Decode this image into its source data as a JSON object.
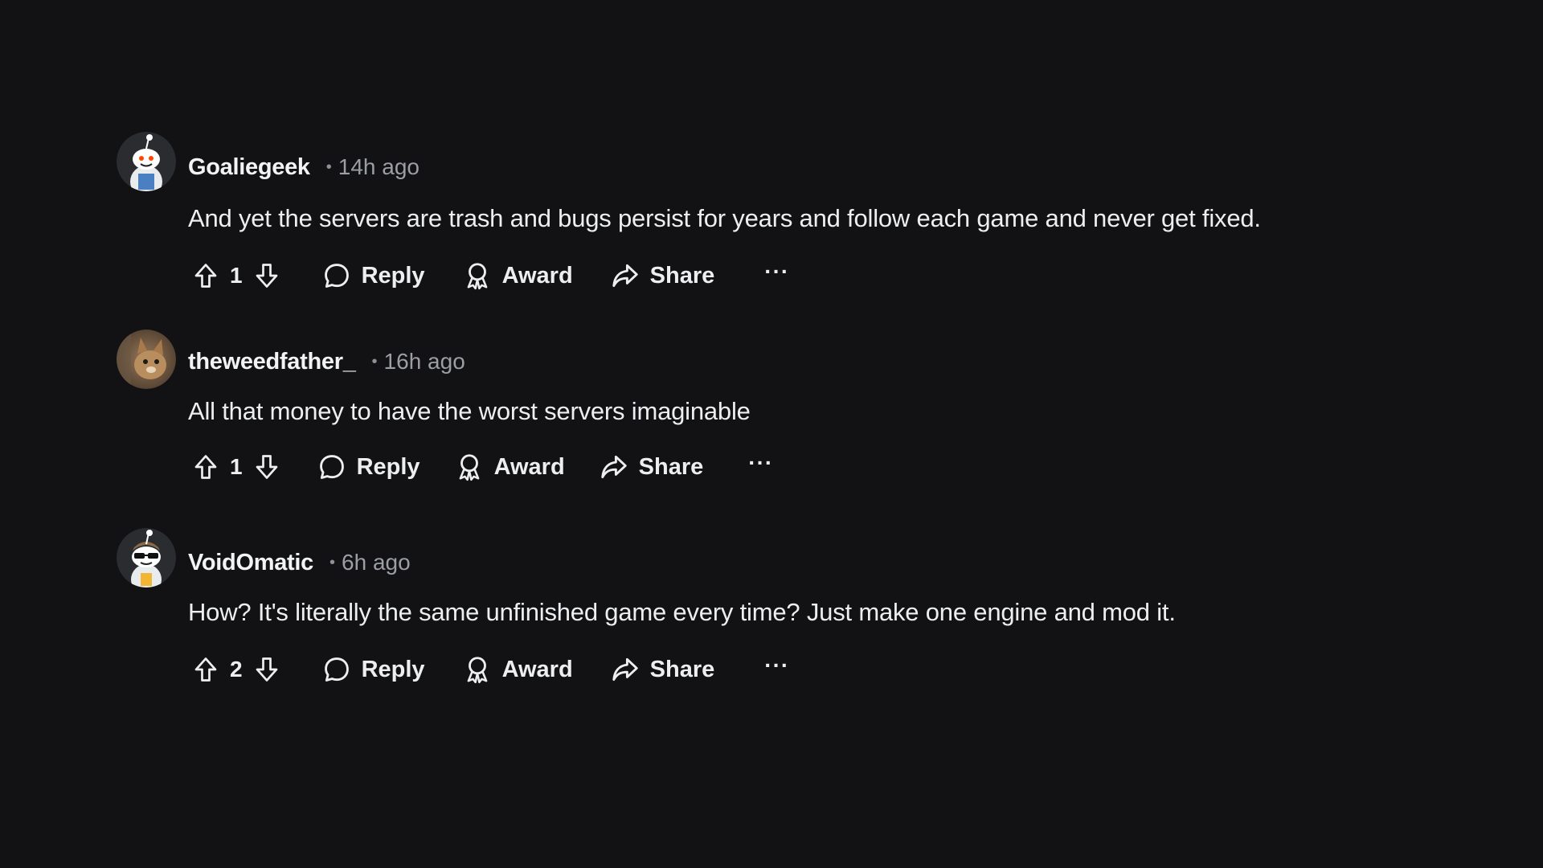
{
  "comments": [
    {
      "username": "Goaliegeek",
      "separator": "•",
      "time": "14h ago",
      "text": "And yet the servers are trash and bugs persist for years and follow each game and never get fixed.",
      "score": "1",
      "reply_label": "Reply",
      "award_label": "Award",
      "share_label": "Share",
      "more_label": "···",
      "avatar_icon": "snoo-avatar-icon"
    },
    {
      "username": "theweedfather_",
      "separator": "•",
      "time": "16h ago",
      "text": "All that money to have the worst servers imaginable",
      "score": "1",
      "reply_label": "Reply",
      "award_label": "Award",
      "share_label": "Share",
      "more_label": "···",
      "avatar_icon": "cat-photo-avatar-icon"
    },
    {
      "username": "VoidOmatic",
      "separator": "•",
      "time": "6h ago",
      "text": "How? It's literally the same unfinished game every time? Just make one engine and mod it.",
      "score": "2",
      "reply_label": "Reply",
      "award_label": "Award",
      "share_label": "Share",
      "more_label": "···",
      "avatar_icon": "snoo-sunglasses-avatar-icon"
    }
  ],
  "colors": {
    "background": "#121215",
    "text": "#eceef0",
    "muted": "#9b9ea3"
  }
}
